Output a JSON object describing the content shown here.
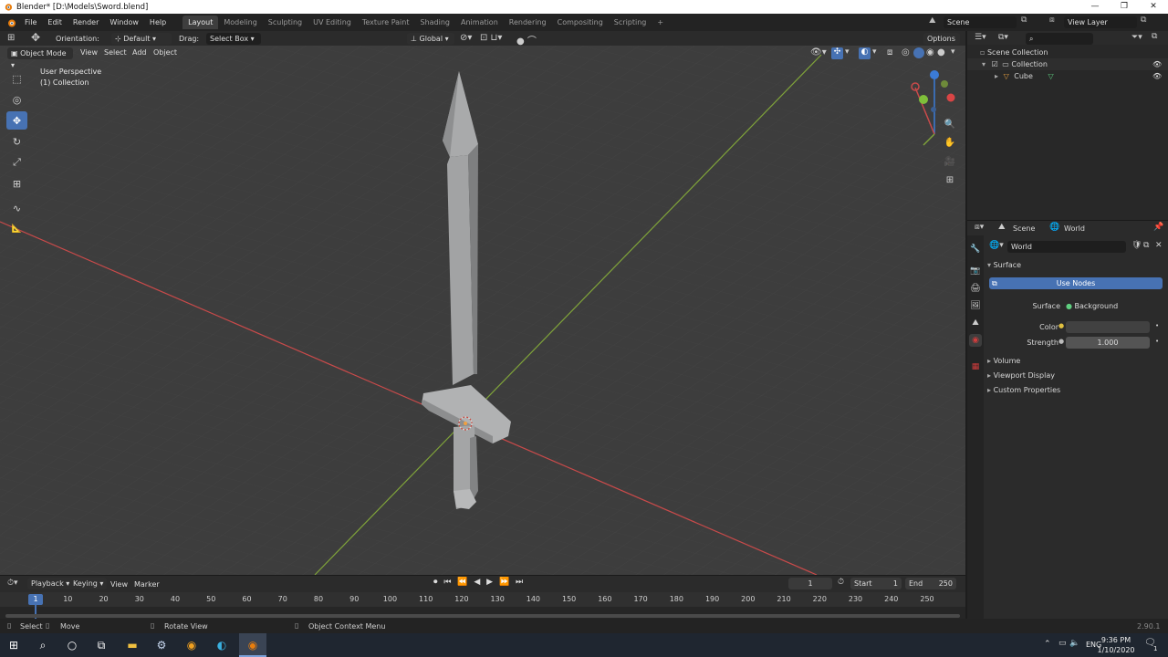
{
  "window": {
    "title": "Blender* [D:\\Models\\Sword.blend]",
    "controls": [
      "—",
      "❐",
      "✕"
    ]
  },
  "menubar": {
    "items": [
      "File",
      "Edit",
      "Render",
      "Window",
      "Help"
    ],
    "workspaces": [
      "Layout",
      "Modeling",
      "Sculpting",
      "UV Editing",
      "Texture Paint",
      "Shading",
      "Animation",
      "Rendering",
      "Compositing",
      "Scripting"
    ],
    "active_workspace": "Layout",
    "add_workspace": "+",
    "scene_label": "Scene",
    "view_layer_label": "View Layer"
  },
  "tool_header": {
    "orientation_label": "Orientation:",
    "orientation_value": "Default",
    "drag_label": "Drag:",
    "drag_value": "Select Box",
    "transform_orientation": "Global",
    "options_label": "Options"
  },
  "viewport": {
    "mode": "Object Mode",
    "menus": [
      "View",
      "Select",
      "Add",
      "Object"
    ],
    "perspective_label": "User Perspective",
    "collection_label": "(1) Collection",
    "gizmo_axes": [
      "X",
      "Y",
      "Z"
    ]
  },
  "toolbar": {
    "tools": [
      {
        "name": "select-box",
        "glyph": "⬚"
      },
      {
        "name": "cursor",
        "glyph": "◎"
      },
      {
        "name": "move",
        "glyph": "✥"
      },
      {
        "name": "rotate",
        "glyph": "↻"
      },
      {
        "name": "scale",
        "glyph": "⤢"
      },
      {
        "name": "transform",
        "glyph": "⊞"
      },
      {
        "name": "annotate",
        "glyph": "∿"
      },
      {
        "name": "measure",
        "glyph": "📐"
      }
    ],
    "active_tool_index": 2
  },
  "outliner": {
    "root": "Scene Collection",
    "collection": "Collection",
    "object": "Cube"
  },
  "properties": {
    "breadcrumb_scene": "Scene",
    "breadcrumb_world": "World",
    "world_name": "World",
    "surface_panel": "Surface",
    "use_nodes_label": "Use Nodes",
    "surface_label": "Surface",
    "surface_value": "Background",
    "color_label": "Color",
    "strength_label": "Strength",
    "strength_value": "1.000",
    "collapsed_panels": [
      "Volume",
      "Viewport Display",
      "Custom Properties"
    ]
  },
  "timeline": {
    "menus": [
      "Playback",
      "Keying",
      "View",
      "Marker"
    ],
    "current_frame": "1",
    "start_label": "Start",
    "start_value": "1",
    "end_label": "End",
    "end_value": "250",
    "ruler_ticks": [
      "1",
      "10",
      "20",
      "30",
      "40",
      "50",
      "60",
      "70",
      "80",
      "90",
      "100",
      "110",
      "120",
      "130",
      "140",
      "150",
      "160",
      "170",
      "180",
      "190",
      "200",
      "210",
      "220",
      "230",
      "240",
      "250"
    ]
  },
  "statusbar": {
    "select_label": "Select",
    "move_label": "Move",
    "rotate_view_label": "Rotate View",
    "context_menu_label": "Object Context Menu",
    "version": "2.90.1"
  },
  "taskbar": {
    "language": "ENG",
    "time": "9:36 PM",
    "date": "1/10/2020",
    "notification_count": "1"
  },
  "colors": {
    "accent_blue": "#4772b3",
    "x_axis_red": "#c94a4a",
    "y_axis_green": "#7fa33a",
    "world_red": "#d03c3c"
  }
}
